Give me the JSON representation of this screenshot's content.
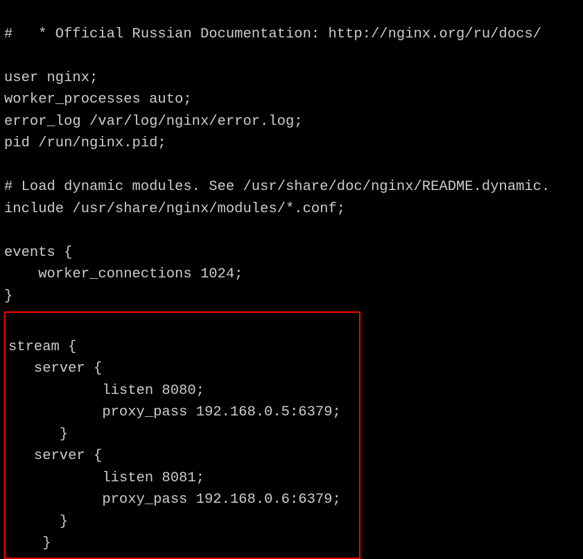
{
  "config": {
    "lines_top": [
      "#   * Official Russian Documentation: http://nginx.org/ru/docs/",
      "",
      "user nginx;",
      "worker_processes auto;",
      "error_log /var/log/nginx/error.log;",
      "pid /run/nginx.pid;",
      "",
      "# Load dynamic modules. See /usr/share/doc/nginx/README.dynamic.",
      "include /usr/share/nginx/modules/*.conf;",
      "",
      "events {",
      "    worker_connections 1024;",
      "}"
    ],
    "lines_highlight": [
      "stream {",
      "   server {",
      "           listen 8080;",
      "           proxy_pass 192.168.0.5:6379;",
      "      }",
      "   server {",
      "           listen 8081;",
      "           proxy_pass 192.168.0.6:6379;",
      "      }",
      "    }"
    ]
  }
}
